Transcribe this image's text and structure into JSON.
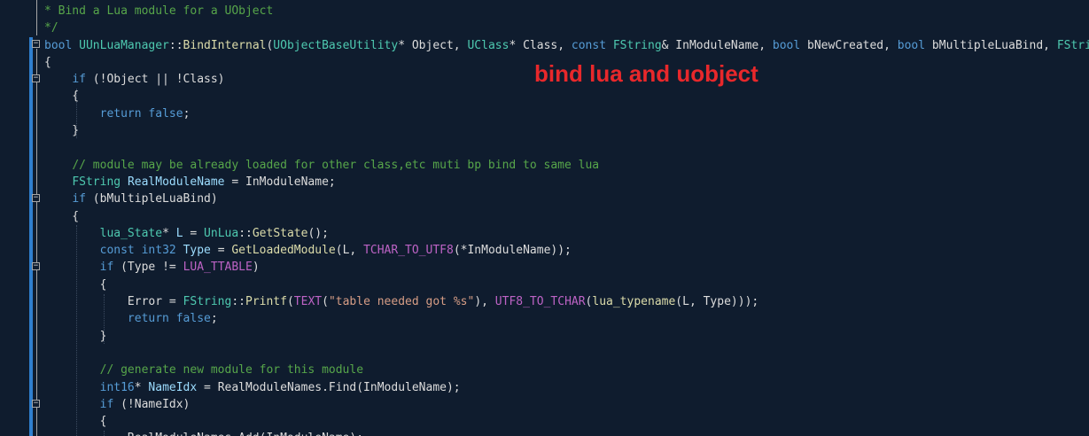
{
  "overlay_label": "bind lua and uobject",
  "colors": {
    "background": "#0f1c2e",
    "keyword": "#569cd6",
    "type": "#4ec9b0",
    "function": "#dcdcaa",
    "comment": "#57a64a",
    "string": "#d69d85",
    "annotation": "#e8282b",
    "change_bar": "#2f7fcf"
  },
  "lines": [
    [
      {
        "c": "cm",
        "t": "* Bind a Lua module for a UObject"
      }
    ],
    [
      {
        "c": "cm",
        "t": "*/"
      }
    ],
    [
      {
        "c": "kw",
        "t": "bool"
      },
      {
        "c": "txt",
        "t": " "
      },
      {
        "c": "ty",
        "t": "UUnLuaManager"
      },
      {
        "c": "txt",
        "t": "::"
      },
      {
        "c": "fn",
        "t": "BindInternal"
      },
      {
        "c": "txt",
        "t": "("
      },
      {
        "c": "ty",
        "t": "UObjectBaseUtility"
      },
      {
        "c": "txt",
        "t": "* Object, "
      },
      {
        "c": "ty",
        "t": "UClass"
      },
      {
        "c": "txt",
        "t": "* Class, "
      },
      {
        "c": "kw",
        "t": "const"
      },
      {
        "c": "txt",
        "t": " "
      },
      {
        "c": "ty",
        "t": "FString"
      },
      {
        "c": "txt",
        "t": "& InModuleName, "
      },
      {
        "c": "kw",
        "t": "bool"
      },
      {
        "c": "txt",
        "t": " bNewCreated, "
      },
      {
        "c": "kw",
        "t": "bool"
      },
      {
        "c": "txt",
        "t": " bMultipleLuaBind, "
      },
      {
        "c": "ty",
        "t": "FStri"
      }
    ],
    [
      {
        "c": "txt",
        "t": "{"
      }
    ],
    [
      {
        "c": "txt",
        "t": "    "
      },
      {
        "c": "kw",
        "t": "if"
      },
      {
        "c": "txt",
        "t": " (!Object || !Class)"
      }
    ],
    [
      {
        "c": "txt",
        "t": "    {"
      }
    ],
    [
      {
        "c": "txt",
        "t": "        "
      },
      {
        "c": "kw",
        "t": "return"
      },
      {
        "c": "txt",
        "t": " "
      },
      {
        "c": "kw",
        "t": "false"
      },
      {
        "c": "txt",
        "t": ";"
      }
    ],
    [
      {
        "c": "txt",
        "t": "    }"
      }
    ],
    [
      {
        "c": "txt",
        "t": ""
      }
    ],
    [
      {
        "c": "txt",
        "t": "    "
      },
      {
        "c": "cm",
        "t": "// module may be already loaded for other class,etc muti bp bind to same lua"
      }
    ],
    [
      {
        "c": "txt",
        "t": "    "
      },
      {
        "c": "ty",
        "t": "FString"
      },
      {
        "c": "txt",
        "t": " "
      },
      {
        "c": "id",
        "t": "RealModuleName"
      },
      {
        "c": "txt",
        "t": " = InModuleName;"
      }
    ],
    [
      {
        "c": "txt",
        "t": "    "
      },
      {
        "c": "kw",
        "t": "if"
      },
      {
        "c": "txt",
        "t": " (bMultipleLuaBind)"
      }
    ],
    [
      {
        "c": "txt",
        "t": "    {"
      }
    ],
    [
      {
        "c": "txt",
        "t": "        "
      },
      {
        "c": "ty",
        "t": "lua_State"
      },
      {
        "c": "txt",
        "t": "* "
      },
      {
        "c": "id",
        "t": "L"
      },
      {
        "c": "txt",
        "t": " = "
      },
      {
        "c": "ty",
        "t": "UnLua"
      },
      {
        "c": "txt",
        "t": "::"
      },
      {
        "c": "fn",
        "t": "GetState"
      },
      {
        "c": "txt",
        "t": "();"
      }
    ],
    [
      {
        "c": "txt",
        "t": "        "
      },
      {
        "c": "kw",
        "t": "const"
      },
      {
        "c": "txt",
        "t": " "
      },
      {
        "c": "kw",
        "t": "int32"
      },
      {
        "c": "txt",
        "t": " "
      },
      {
        "c": "id",
        "t": "Type"
      },
      {
        "c": "txt",
        "t": " = "
      },
      {
        "c": "fn",
        "t": "GetLoadedModule"
      },
      {
        "c": "txt",
        "t": "(L, "
      },
      {
        "c": "mac",
        "t": "TCHAR_TO_UTF8"
      },
      {
        "c": "txt",
        "t": "(*InModuleName));"
      }
    ],
    [
      {
        "c": "txt",
        "t": "        "
      },
      {
        "c": "kw",
        "t": "if"
      },
      {
        "c": "txt",
        "t": " (Type != "
      },
      {
        "c": "mac",
        "t": "LUA_TTABLE"
      },
      {
        "c": "txt",
        "t": ")"
      }
    ],
    [
      {
        "c": "txt",
        "t": "        {"
      }
    ],
    [
      {
        "c": "txt",
        "t": "            Error = "
      },
      {
        "c": "ty",
        "t": "FString"
      },
      {
        "c": "txt",
        "t": "::"
      },
      {
        "c": "fn",
        "t": "Printf"
      },
      {
        "c": "txt",
        "t": "("
      },
      {
        "c": "mac",
        "t": "TEXT"
      },
      {
        "c": "txt",
        "t": "("
      },
      {
        "c": "st",
        "t": "\"table needed got %s\""
      },
      {
        "c": "txt",
        "t": "), "
      },
      {
        "c": "mac",
        "t": "UTF8_TO_TCHAR"
      },
      {
        "c": "txt",
        "t": "("
      },
      {
        "c": "fn",
        "t": "lua_typename"
      },
      {
        "c": "txt",
        "t": "(L, Type)));"
      }
    ],
    [
      {
        "c": "txt",
        "t": "            "
      },
      {
        "c": "kw",
        "t": "return"
      },
      {
        "c": "txt",
        "t": " "
      },
      {
        "c": "kw",
        "t": "false"
      },
      {
        "c": "txt",
        "t": ";"
      }
    ],
    [
      {
        "c": "txt",
        "t": "        }"
      }
    ],
    [
      {
        "c": "txt",
        "t": ""
      }
    ],
    [
      {
        "c": "txt",
        "t": "        "
      },
      {
        "c": "cm",
        "t": "// generate new module for this module"
      }
    ],
    [
      {
        "c": "txt",
        "t": "        "
      },
      {
        "c": "kw",
        "t": "int16"
      },
      {
        "c": "txt",
        "t": "* "
      },
      {
        "c": "id",
        "t": "NameIdx"
      },
      {
        "c": "txt",
        "t": " = RealModuleNames.Find(InModuleName);"
      }
    ],
    [
      {
        "c": "txt",
        "t": "        "
      },
      {
        "c": "kw",
        "t": "if"
      },
      {
        "c": "txt",
        "t": " (!NameIdx)"
      }
    ],
    [
      {
        "c": "txt",
        "t": "        {"
      }
    ],
    [
      {
        "c": "txt",
        "t": "            RealModuleNames.Add(InModuleName);"
      }
    ]
  ]
}
